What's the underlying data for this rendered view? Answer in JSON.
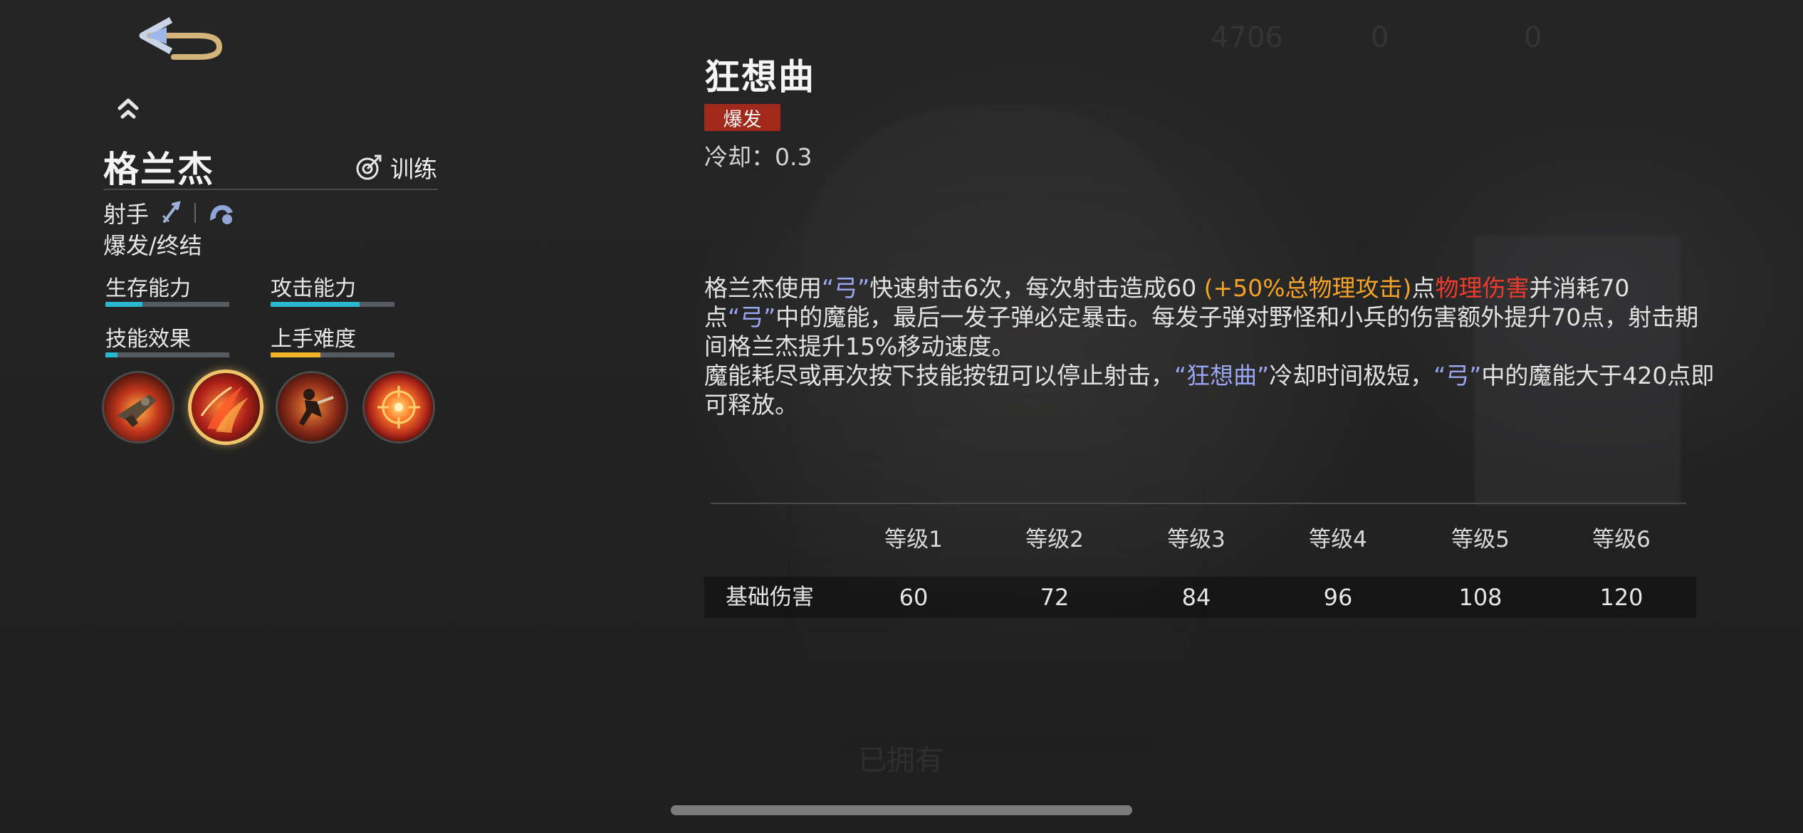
{
  "hero": {
    "name": "格兰杰",
    "train_label": "训练",
    "role": "射手",
    "tags": "爆发/终结",
    "stats": [
      {
        "label": "生存能力",
        "value": 0.3,
        "color": "#2ab7d0"
      },
      {
        "label": "攻击能力",
        "value": 0.72,
        "color": "#2ab7d0"
      },
      {
        "label": "技能效果",
        "value": 0.1,
        "color": "#2ab7d0"
      },
      {
        "label": "上手难度",
        "value": 0.4,
        "color": "#f0b429"
      }
    ],
    "skills": [
      {
        "icon": "revolver-skill-icon",
        "selected": false
      },
      {
        "icon": "rhapsody-skill-icon",
        "selected": true
      },
      {
        "icon": "dash-skill-icon",
        "selected": false
      },
      {
        "icon": "target-skill-icon",
        "selected": false
      }
    ]
  },
  "skill": {
    "title": "狂想曲",
    "tag": "爆发",
    "cooldown": "冷却：0.3",
    "desc": {
      "l1_a": "格兰杰使用",
      "l1_q": "“弓”",
      "l1_b": "快速射击6次，每次射击造成60 ",
      "l1_orange": "(+50%总物理攻击)",
      "l1_c": "点",
      "l1_red": "物理伤害",
      "l1_d": "并消耗70点",
      "l2_q": "“弓”",
      "l2_b": "中的魔能，最后一发子弹必定暴击。每发子弹对野怪和小兵的伤害额外提升70点，射击期间格兰杰提升15%移动速度。",
      "p2_a": "魔能耗尽或再次按下技能按钮可以停止射击，",
      "p2_q1": "“狂想曲”",
      "p2_b": "冷却时间极短，",
      "p2_q2": "“弓”",
      "p2_c": "中的魔能大于420点即可释放。"
    }
  },
  "levels": {
    "headers": [
      "等级1",
      "等级2",
      "等级3",
      "等级4",
      "等级5",
      "等级6"
    ],
    "row_label": "基础伤害",
    "values": [
      "60",
      "72",
      "84",
      "96",
      "108",
      "120"
    ]
  },
  "background_text": {
    "coins": "4706",
    "gems_a": "0",
    "gems_b": "0",
    "owned": "已拥有"
  }
}
